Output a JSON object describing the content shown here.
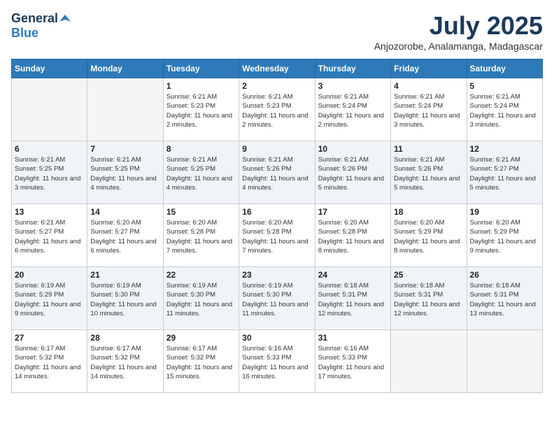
{
  "logo": {
    "general": "General",
    "blue": "Blue"
  },
  "title": "July 2025",
  "location": "Anjozorobe, Analamanga, Madagascar",
  "days_header": [
    "Sunday",
    "Monday",
    "Tuesday",
    "Wednesday",
    "Thursday",
    "Friday",
    "Saturday"
  ],
  "weeks": [
    [
      {
        "day": "",
        "empty": true
      },
      {
        "day": "",
        "empty": true
      },
      {
        "day": "1",
        "info": "Sunrise: 6:21 AM\nSunset: 5:23 PM\nDaylight: 11 hours and 2 minutes."
      },
      {
        "day": "2",
        "info": "Sunrise: 6:21 AM\nSunset: 5:23 PM\nDaylight: 11 hours and 2 minutes."
      },
      {
        "day": "3",
        "info": "Sunrise: 6:21 AM\nSunset: 5:24 PM\nDaylight: 11 hours and 2 minutes."
      },
      {
        "day": "4",
        "info": "Sunrise: 6:21 AM\nSunset: 5:24 PM\nDaylight: 11 hours and 3 minutes."
      },
      {
        "day": "5",
        "info": "Sunrise: 6:21 AM\nSunset: 5:24 PM\nDaylight: 11 hours and 3 minutes."
      }
    ],
    [
      {
        "day": "6",
        "info": "Sunrise: 6:21 AM\nSunset: 5:25 PM\nDaylight: 11 hours and 3 minutes."
      },
      {
        "day": "7",
        "info": "Sunrise: 6:21 AM\nSunset: 5:25 PM\nDaylight: 11 hours and 4 minutes."
      },
      {
        "day": "8",
        "info": "Sunrise: 6:21 AM\nSunset: 5:25 PM\nDaylight: 11 hours and 4 minutes."
      },
      {
        "day": "9",
        "info": "Sunrise: 6:21 AM\nSunset: 5:26 PM\nDaylight: 11 hours and 4 minutes."
      },
      {
        "day": "10",
        "info": "Sunrise: 6:21 AM\nSunset: 5:26 PM\nDaylight: 11 hours and 5 minutes."
      },
      {
        "day": "11",
        "info": "Sunrise: 6:21 AM\nSunset: 5:26 PM\nDaylight: 11 hours and 5 minutes."
      },
      {
        "day": "12",
        "info": "Sunrise: 6:21 AM\nSunset: 5:27 PM\nDaylight: 11 hours and 5 minutes."
      }
    ],
    [
      {
        "day": "13",
        "info": "Sunrise: 6:21 AM\nSunset: 5:27 PM\nDaylight: 11 hours and 6 minutes."
      },
      {
        "day": "14",
        "info": "Sunrise: 6:20 AM\nSunset: 5:27 PM\nDaylight: 11 hours and 6 minutes."
      },
      {
        "day": "15",
        "info": "Sunrise: 6:20 AM\nSunset: 5:28 PM\nDaylight: 11 hours and 7 minutes."
      },
      {
        "day": "16",
        "info": "Sunrise: 6:20 AM\nSunset: 5:28 PM\nDaylight: 11 hours and 7 minutes."
      },
      {
        "day": "17",
        "info": "Sunrise: 6:20 AM\nSunset: 5:28 PM\nDaylight: 11 hours and 8 minutes."
      },
      {
        "day": "18",
        "info": "Sunrise: 6:20 AM\nSunset: 5:29 PM\nDaylight: 11 hours and 8 minutes."
      },
      {
        "day": "19",
        "info": "Sunrise: 6:20 AM\nSunset: 5:29 PM\nDaylight: 11 hours and 9 minutes."
      }
    ],
    [
      {
        "day": "20",
        "info": "Sunrise: 6:19 AM\nSunset: 5:29 PM\nDaylight: 11 hours and 9 minutes."
      },
      {
        "day": "21",
        "info": "Sunrise: 6:19 AM\nSunset: 5:30 PM\nDaylight: 11 hours and 10 minutes."
      },
      {
        "day": "22",
        "info": "Sunrise: 6:19 AM\nSunset: 5:30 PM\nDaylight: 11 hours and 11 minutes."
      },
      {
        "day": "23",
        "info": "Sunrise: 6:19 AM\nSunset: 5:30 PM\nDaylight: 11 hours and 11 minutes."
      },
      {
        "day": "24",
        "info": "Sunrise: 6:18 AM\nSunset: 5:31 PM\nDaylight: 11 hours and 12 minutes."
      },
      {
        "day": "25",
        "info": "Sunrise: 6:18 AM\nSunset: 5:31 PM\nDaylight: 11 hours and 12 minutes."
      },
      {
        "day": "26",
        "info": "Sunrise: 6:18 AM\nSunset: 5:31 PM\nDaylight: 11 hours and 13 minutes."
      }
    ],
    [
      {
        "day": "27",
        "info": "Sunrise: 6:17 AM\nSunset: 5:32 PM\nDaylight: 11 hours and 14 minutes."
      },
      {
        "day": "28",
        "info": "Sunrise: 6:17 AM\nSunset: 5:32 PM\nDaylight: 11 hours and 14 minutes."
      },
      {
        "day": "29",
        "info": "Sunrise: 6:17 AM\nSunset: 5:32 PM\nDaylight: 11 hours and 15 minutes."
      },
      {
        "day": "30",
        "info": "Sunrise: 6:16 AM\nSunset: 5:33 PM\nDaylight: 11 hours and 16 minutes."
      },
      {
        "day": "31",
        "info": "Sunrise: 6:16 AM\nSunset: 5:33 PM\nDaylight: 11 hours and 17 minutes."
      },
      {
        "day": "",
        "empty": true
      },
      {
        "day": "",
        "empty": true
      }
    ]
  ]
}
